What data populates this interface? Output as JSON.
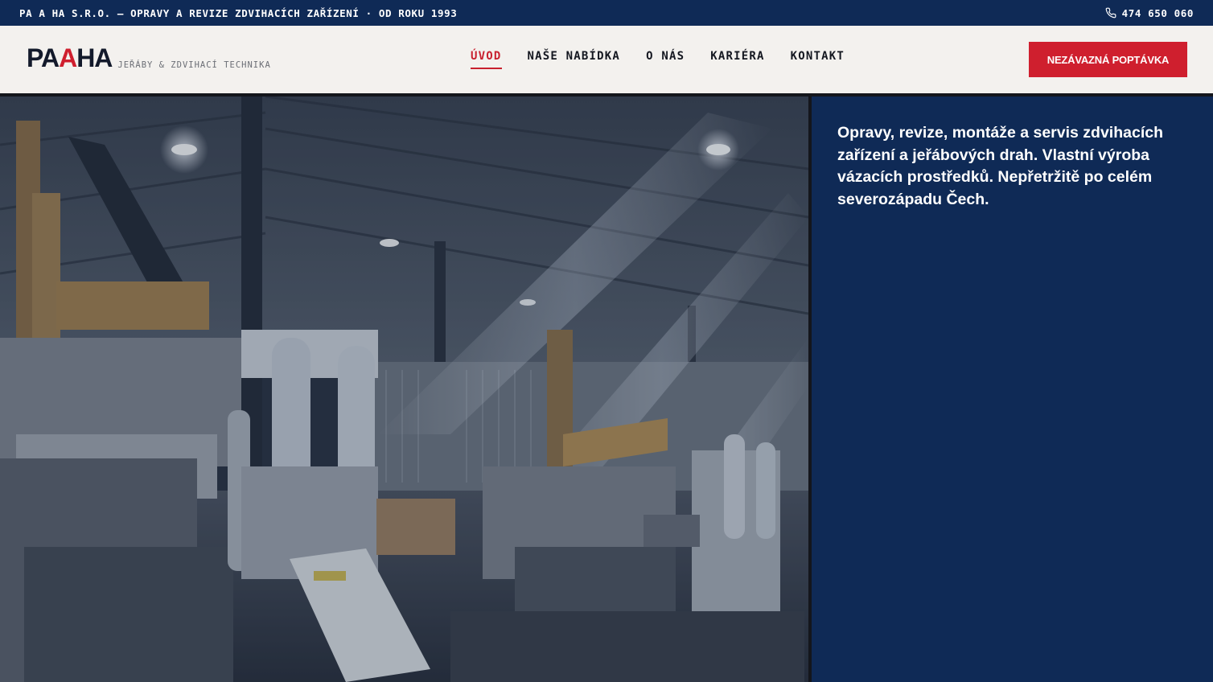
{
  "topbar": {
    "tagline": "PA A HA S.R.O. — OPRAVY A REVIZE ZDVIHACÍCH ZAŘÍZENÍ · OD ROKU 1993",
    "phone": "474 650 060",
    "phone_icon": "phone-icon"
  },
  "header": {
    "logo": {
      "part1": "PA",
      "part2": "A",
      "part3": "HA",
      "tagline": "JEŘÁBY & ZDVIHACÍ TECHNIKA"
    },
    "nav": [
      {
        "label": "ÚVOD",
        "active": true
      },
      {
        "label": "NAŠE NABÍDKA",
        "active": false
      },
      {
        "label": "O NÁS",
        "active": false
      },
      {
        "label": "KARIÉRA",
        "active": false
      },
      {
        "label": "KONTAKT",
        "active": false
      }
    ],
    "cta_label": "NEZÁVAZNÁ POPTÁVKA"
  },
  "panel": {
    "intro": "Opravy, revize, montáže a servis zdvihacích zařízení a jeřábových drah. Vlastní výroba vázacích prostředků. Nepřetržitě po celém severozápadu Čech."
  },
  "colors": {
    "navy": "#0f2a56",
    "accent_red": "#cf1f2e",
    "header_bg": "#f3f1ee",
    "ink": "#131a2b"
  }
}
